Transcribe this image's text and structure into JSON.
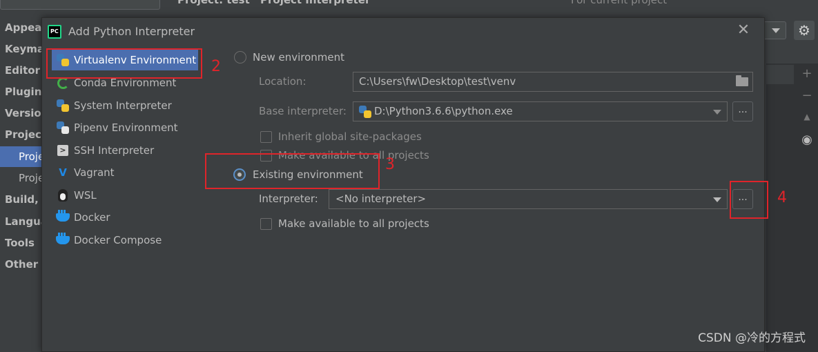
{
  "background": {
    "sidebar_items": [
      "Appear",
      "Keyma",
      "Editor",
      "Plugins",
      "Version",
      "Project",
      "Build, E",
      "Langua",
      "Tools",
      "Other S"
    ],
    "sidebar_subitems": [
      "Proje",
      "Proje"
    ],
    "header_tabs": [
      "Project: test",
      "Project Interpreter"
    ],
    "header_note": "For current project"
  },
  "dialog": {
    "title": "Add Python Interpreter",
    "env_types": [
      {
        "label": "Virtualenv Environment",
        "icon": "python-icon",
        "selected": true
      },
      {
        "label": "Conda Environment",
        "icon": "conda-icon"
      },
      {
        "label": "System Interpreter",
        "icon": "python-icon"
      },
      {
        "label": "Pipenv Environment",
        "icon": "pipenv-icon"
      },
      {
        "label": "SSH Interpreter",
        "icon": "terminal-icon"
      },
      {
        "label": "Vagrant",
        "icon": "vagrant-icon"
      },
      {
        "label": "WSL",
        "icon": "linux-icon"
      },
      {
        "label": "Docker",
        "icon": "docker-icon"
      },
      {
        "label": "Docker Compose",
        "icon": "docker-icon"
      }
    ],
    "new_env": {
      "label": "New environment",
      "location_label": "Location:",
      "location_value": "C:\\Users\\fw\\Desktop\\test\\venv",
      "base_label": "Base interpreter:",
      "base_value": "D:\\Python3.6.6\\python.exe",
      "inherit_label": "Inherit global site-packages",
      "make_available_label": "Make available to all projects"
    },
    "existing_env": {
      "label": "Existing environment",
      "interpreter_label": "Interpreter:",
      "interpreter_value": "<No interpreter>",
      "ellipsis": "...",
      "make_available_label": "Make available to all projects"
    },
    "annotations": [
      "2",
      "3",
      "4"
    ]
  },
  "watermark": "CSDN @冷的方程式",
  "colors": {
    "selection": "#4b6eaf",
    "annotation": "#e0242a",
    "background": "#3c3f41"
  }
}
